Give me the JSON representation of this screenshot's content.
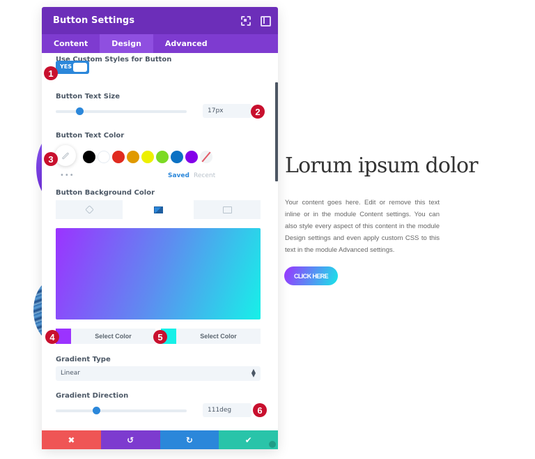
{
  "panel": {
    "title": "Button Settings",
    "header_icons": [
      "expand-icon",
      "sidebar-icon"
    ],
    "tabs": [
      {
        "label": "Content",
        "active": false
      },
      {
        "label": "Design",
        "active": true
      },
      {
        "label": "Advanced",
        "active": false
      }
    ]
  },
  "settings": {
    "custom_styles": {
      "label": "Use Custom Styles for Button",
      "value": "YES",
      "enabled": true
    },
    "text_size": {
      "label": "Button Text Size",
      "value": "17px",
      "slider_fraction": 0.18
    },
    "text_color": {
      "label": "Button Text Color",
      "more": "•••",
      "swatches": [
        "#000000",
        "#ffffff",
        "#e02b20",
        "#e09900",
        "#edf000",
        "#7cda24",
        "#0c71c3",
        "#8300e9",
        "none"
      ],
      "saved_label": "Saved",
      "recent_label": "Recent"
    },
    "background_color": {
      "label": "Button Background Color",
      "tabs": [
        {
          "icon": "paint-bucket-icon",
          "active": false
        },
        {
          "icon": "gradient-icon",
          "active": true
        },
        {
          "icon": "image-icon",
          "active": false
        }
      ],
      "gradient_start": "#9b33ff",
      "gradient_end": "#17f0e8",
      "stop1_label": "Select Color",
      "stop2_label": "Select Color"
    },
    "gradient_type": {
      "label": "Gradient Type",
      "value": "Linear"
    },
    "gradient_direction": {
      "label": "Gradient Direction",
      "value": "111deg",
      "slider_fraction": 0.31
    }
  },
  "badges": [
    "1",
    "2",
    "3",
    "4",
    "5",
    "6"
  ],
  "footer": {
    "cancel": "✖",
    "undo": "↺",
    "redo": "↻",
    "save": "✔",
    "colors": {
      "cancel": "#ef5555",
      "undo": "#7d3bcf",
      "redo": "#2b87da",
      "save": "#29c4a9"
    }
  },
  "preview": {
    "heading": "Lorum ipsum dolor",
    "body": "Your content goes here. Edit or remove this text inline or in the module Content settings. You can also style every aspect of this content in the module Design settings and even apply custom CSS to this text in the module Advanced settings.",
    "button_label": "CLICK HERE"
  }
}
